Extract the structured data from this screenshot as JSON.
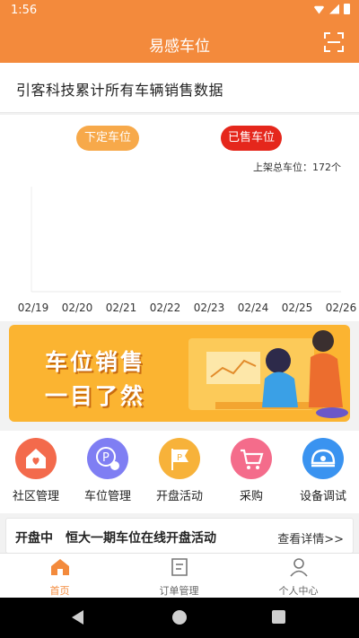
{
  "status_bar": {
    "time": "1:56"
  },
  "app": {
    "title": "易感车位"
  },
  "heading": {
    "text": "引客科技累计所有车辆销售数据"
  },
  "legend": {
    "pending_label": "下定车位",
    "pending_color": "#f7a94a",
    "sold_label": "已售车位",
    "sold_color": "#e5271c"
  },
  "total_label": "上架总车位：172个",
  "chart_data": {
    "type": "line",
    "x": [
      "02/19",
      "02/20",
      "02/21",
      "02/22",
      "02/23",
      "02/24",
      "02/25",
      "02/26"
    ],
    "series": [
      {
        "name": "下定车位",
        "values": []
      },
      {
        "name": "已售车位",
        "values": []
      }
    ],
    "grid": false
  },
  "banner": {
    "line1": "车位销售",
    "line2": "一目了然"
  },
  "menu": [
    {
      "label": "社区管理",
      "icon": "community-house-icon",
      "color": "#f36a4c"
    },
    {
      "label": "车位管理",
      "icon": "parking-manage-icon",
      "color": "#7f7ef3"
    },
    {
      "label": "开盘活动",
      "icon": "opening-flag-icon",
      "color": "#f7b23a"
    },
    {
      "label": "采购",
      "icon": "cart-icon",
      "color": "#f46c8b"
    },
    {
      "label": "设备调试",
      "icon": "device-debug-icon",
      "color": "#3a93f0"
    }
  ],
  "notice": {
    "status": "开盘中",
    "message": "恒大一期车位在线开盘活动",
    "more": "查看详情>>"
  },
  "tabs": [
    {
      "label": "首页",
      "icon": "home-icon"
    },
    {
      "label": "订单管理",
      "icon": "orders-icon"
    },
    {
      "label": "个人中心",
      "icon": "profile-icon"
    }
  ],
  "colors": {
    "brand": "#f38a3c"
  }
}
